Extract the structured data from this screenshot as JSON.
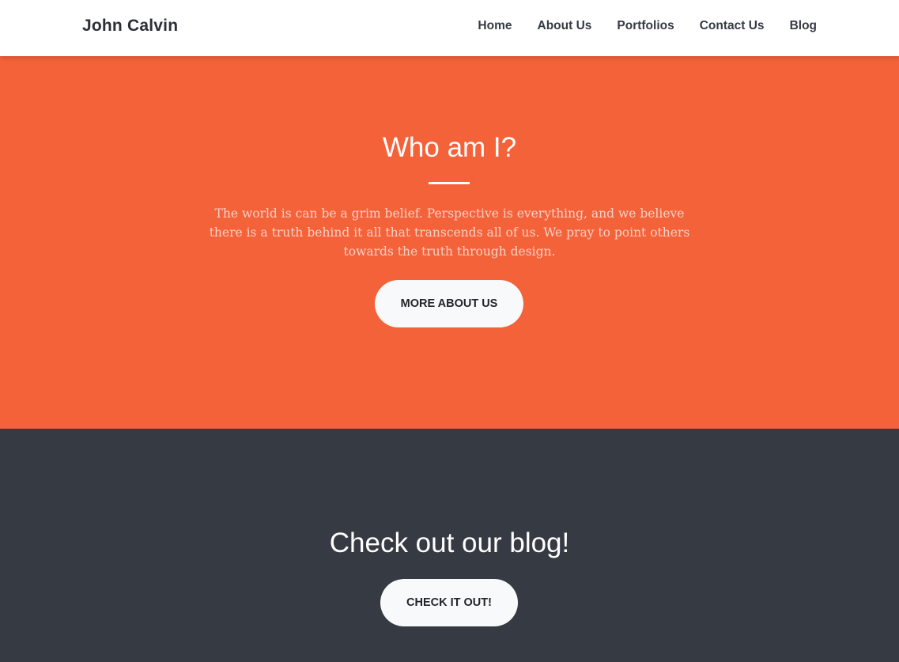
{
  "navbar": {
    "brand": "John Calvin",
    "links": [
      {
        "label": "Home"
      },
      {
        "label": "About Us"
      },
      {
        "label": "Portfolios"
      },
      {
        "label": "Contact Us"
      },
      {
        "label": "Blog"
      }
    ]
  },
  "about": {
    "title": "Who am I?",
    "text": "The world is can be a grim belief. Perspective is everything, and we believe there is a truth behind it all that transcends all of us. We pray to point others towards the truth through design.",
    "button_label": "More About Us"
  },
  "blog": {
    "title": "Check out our blog!",
    "button_label": "Check it out!"
  },
  "colors": {
    "primary": "#f4623a",
    "dark": "#363a43",
    "light": "#f8f9fa",
    "white": "#ffffff"
  }
}
